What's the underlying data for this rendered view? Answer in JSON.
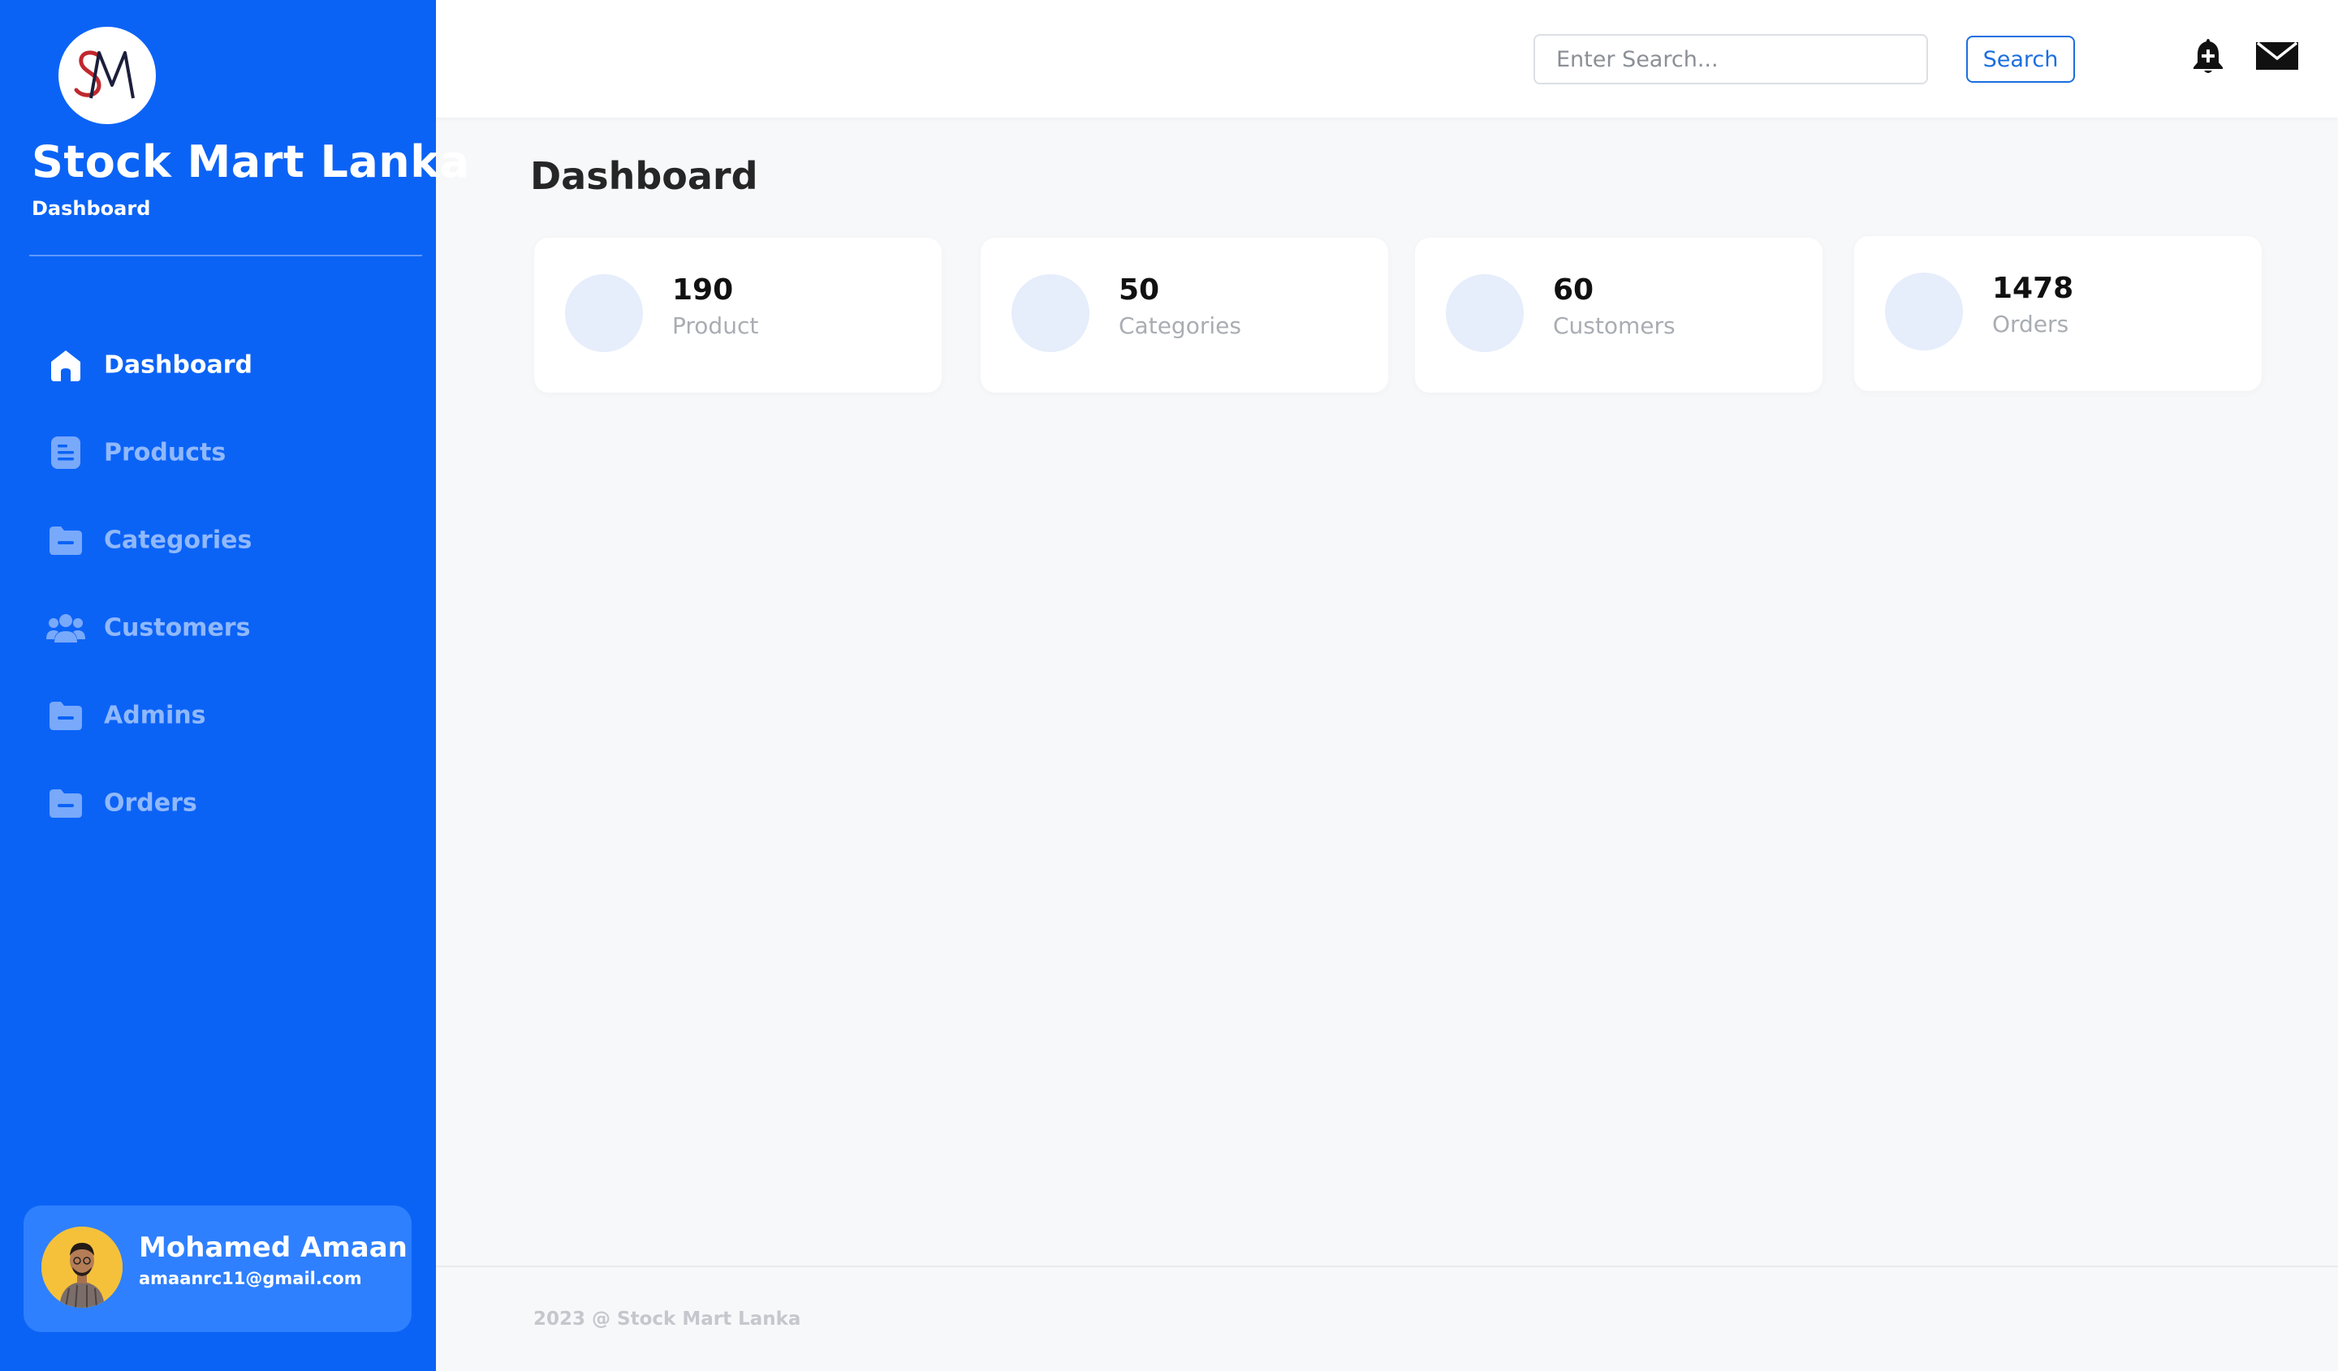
{
  "sidebar": {
    "logo_text": "SM",
    "brand_title": "Stock Mart Lanka",
    "brand_subtitle": "Dashboard",
    "nav": [
      {
        "label": "Dashboard",
        "icon": "home-icon",
        "active": true
      },
      {
        "label": "Products",
        "icon": "document-icon",
        "active": false
      },
      {
        "label": "Categories",
        "icon": "folder-icon",
        "active": false
      },
      {
        "label": "Customers",
        "icon": "users-icon",
        "active": false
      },
      {
        "label": "Admins",
        "icon": "folder-icon",
        "active": false
      },
      {
        "label": "Orders",
        "icon": "folder-icon",
        "active": false
      }
    ],
    "profile": {
      "name": "Mohamed Amaan",
      "email": "amaanrc11@gmail.com"
    }
  },
  "topbar": {
    "search_placeholder": "Enter Search...",
    "search_button": "Search",
    "icons": [
      "bell-plus-icon",
      "mail-icon"
    ]
  },
  "main": {
    "title": "Dashboard",
    "stats": [
      {
        "value": "190",
        "label": "Product"
      },
      {
        "value": "50",
        "label": "Categories"
      },
      {
        "value": "60",
        "label": "Customers"
      },
      {
        "value": "1478",
        "label": "Orders"
      }
    ]
  },
  "footer": {
    "text": "2023 @ Stock Mart Lanka"
  },
  "colors": {
    "sidebar_bg": "#0b63f6",
    "profile_card_bg": "#2f80ff",
    "page_bg": "#f7f8fa",
    "accent": "#1b6fe0",
    "stat_circle": "#e6edfb"
  }
}
